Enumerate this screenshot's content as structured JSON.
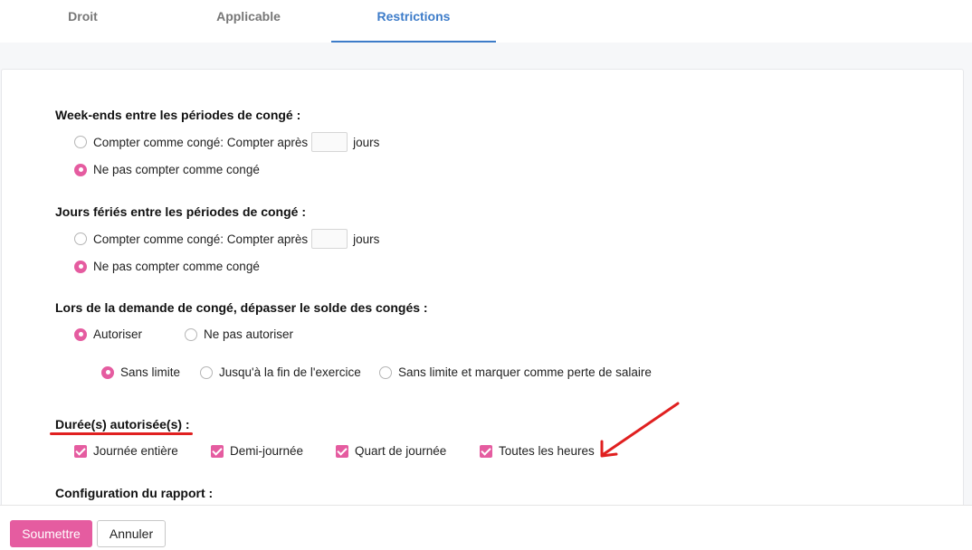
{
  "tabs": [
    {
      "label": "Droit"
    },
    {
      "label": "Applicable"
    },
    {
      "label": "Restrictions",
      "active": true
    }
  ],
  "weekends": {
    "title": "Week-ends entre les périodes de congé :",
    "count_label": "Compter comme congé: Compter après",
    "count_value": "",
    "unit": "jours",
    "no_count_label": "Ne pas compter comme congé",
    "selected": "no_count"
  },
  "holidays": {
    "title": "Jours fériés entre les périodes de congé :",
    "count_label": "Compter comme congé: Compter après",
    "count_value": "",
    "unit": "jours",
    "no_count_label": "Ne pas compter comme congé",
    "selected": "no_count"
  },
  "exceed": {
    "title": "Lors de la demande de congé, dépasser le solde des congés :",
    "allow_label": "Autoriser",
    "deny_label": "Ne pas autoriser",
    "selected": "allow",
    "sub_options": [
      {
        "label": "Sans limite",
        "selected": true
      },
      {
        "label": "Jusqu'à la fin de l'exercice",
        "selected": false
      },
      {
        "label": "Sans limite et marquer comme perte de salaire",
        "selected": false
      }
    ]
  },
  "durations": {
    "title": "Durée(s) autorisée(s) :",
    "items": [
      {
        "label": "Journée entière",
        "checked": true
      },
      {
        "label": "Demi-journée",
        "checked": true
      },
      {
        "label": "Quart de journée",
        "checked": true
      },
      {
        "label": "Toutes les heures",
        "checked": true
      }
    ]
  },
  "report": {
    "title": "Configuration du rapport :"
  },
  "footer": {
    "submit_label": "Soumettre",
    "cancel_label": "Annuler"
  },
  "colors": {
    "accent": "#e55ca0",
    "tab_active": "#3d7cc9",
    "annotation": "#e02020"
  }
}
